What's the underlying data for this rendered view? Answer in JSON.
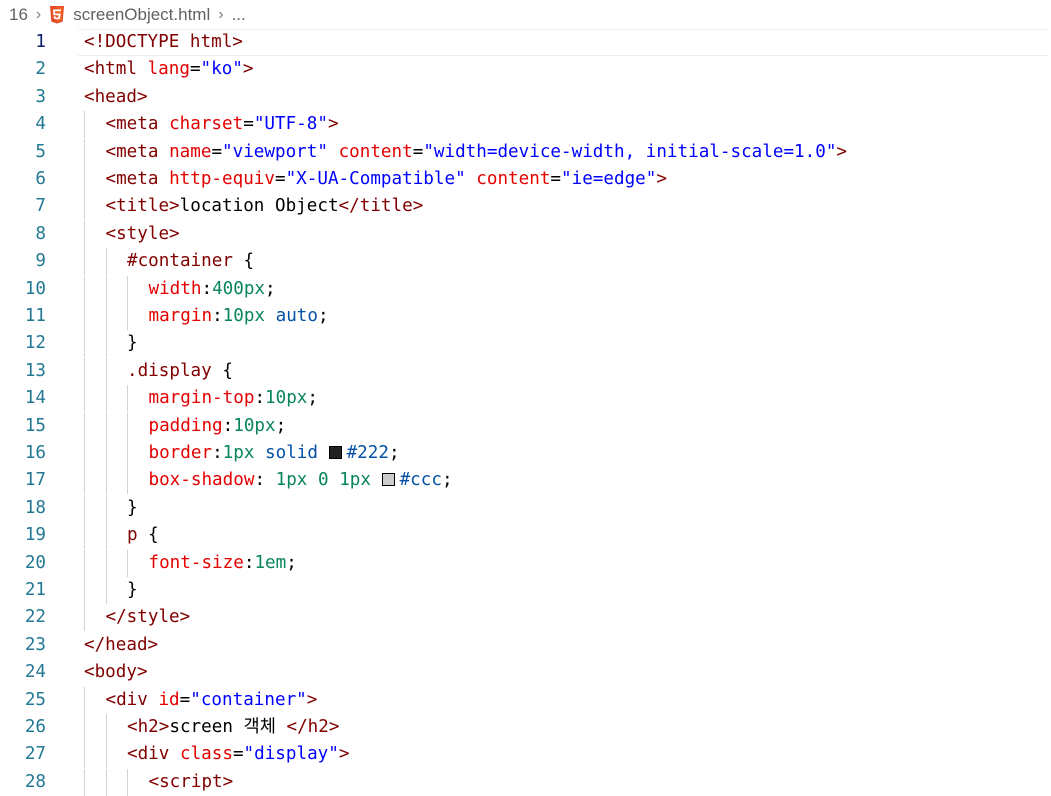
{
  "breadcrumb": {
    "line_ref": "16",
    "file_name": "screenObject.html",
    "more": "..."
  },
  "colors": {
    "line_number": "#237893",
    "tag": "#800000",
    "attribute": "#e50000",
    "string": "#0000ff",
    "number": "#098658",
    "keyword": "#0451a5",
    "html5_icon": "#e44d26"
  },
  "editor": {
    "current_line": 1,
    "lines": [
      {
        "n": "1",
        "indent": 0,
        "tokens": [
          [
            "t-tag",
            "<!DOCTYPE html>"
          ]
        ]
      },
      {
        "n": "2",
        "indent": 0,
        "tokens": [
          [
            "t-tag",
            "<html "
          ],
          [
            "t-attr",
            "lang"
          ],
          [
            "t-plain",
            "="
          ],
          [
            "t-val",
            "\"ko\""
          ],
          [
            "t-tag",
            ">"
          ]
        ]
      },
      {
        "n": "3",
        "indent": 0,
        "tokens": [
          [
            "t-tag",
            "<head>"
          ]
        ]
      },
      {
        "n": "4",
        "indent": 1,
        "tokens": [
          [
            "t-tag",
            "<meta "
          ],
          [
            "t-attr",
            "charset"
          ],
          [
            "t-plain",
            "="
          ],
          [
            "t-val",
            "\"UTF-8\""
          ],
          [
            "t-tag",
            ">"
          ]
        ]
      },
      {
        "n": "5",
        "indent": 1,
        "tokens": [
          [
            "t-tag",
            "<meta "
          ],
          [
            "t-attr",
            "name"
          ],
          [
            "t-plain",
            "="
          ],
          [
            "t-val",
            "\"viewport\""
          ],
          [
            "t-plain",
            " "
          ],
          [
            "t-attr",
            "content"
          ],
          [
            "t-plain",
            "="
          ],
          [
            "t-val",
            "\"width=device-width, initial-scale=1.0\""
          ],
          [
            "t-tag",
            ">"
          ]
        ]
      },
      {
        "n": "6",
        "indent": 1,
        "tokens": [
          [
            "t-tag",
            "<meta "
          ],
          [
            "t-attr",
            "http-equiv"
          ],
          [
            "t-plain",
            "="
          ],
          [
            "t-val",
            "\"X-UA-Compatible\""
          ],
          [
            "t-plain",
            " "
          ],
          [
            "t-attr",
            "content"
          ],
          [
            "t-plain",
            "="
          ],
          [
            "t-val",
            "\"ie=edge\""
          ],
          [
            "t-tag",
            ">"
          ]
        ]
      },
      {
        "n": "7",
        "indent": 1,
        "tokens": [
          [
            "t-tag",
            "<title>"
          ],
          [
            "t-text",
            "location Object"
          ],
          [
            "t-tag",
            "</title>"
          ]
        ]
      },
      {
        "n": "8",
        "indent": 1,
        "tokens": [
          [
            "t-tag",
            "<style>"
          ]
        ]
      },
      {
        "n": "9",
        "indent": 2,
        "tokens": [
          [
            "t-sel",
            "#container"
          ],
          [
            "t-plain",
            " {"
          ]
        ]
      },
      {
        "n": "10",
        "indent": 3,
        "tokens": [
          [
            "t-prop",
            "width"
          ],
          [
            "t-plain",
            ":"
          ],
          [
            "t-num",
            "400px"
          ],
          [
            "t-plain",
            ";"
          ]
        ]
      },
      {
        "n": "11",
        "indent": 3,
        "tokens": [
          [
            "t-prop",
            "margin"
          ],
          [
            "t-plain",
            ":"
          ],
          [
            "t-num",
            "10px"
          ],
          [
            "t-plain",
            " "
          ],
          [
            "t-kw",
            "auto"
          ],
          [
            "t-plain",
            ";"
          ]
        ]
      },
      {
        "n": "12",
        "indent": 2,
        "tokens": [
          [
            "t-plain",
            "}"
          ]
        ]
      },
      {
        "n": "13",
        "indent": 2,
        "tokens": [
          [
            "t-sel",
            ".display"
          ],
          [
            "t-plain",
            " {"
          ]
        ]
      },
      {
        "n": "14",
        "indent": 3,
        "tokens": [
          [
            "t-prop",
            "margin-top"
          ],
          [
            "t-plain",
            ":"
          ],
          [
            "t-num",
            "10px"
          ],
          [
            "t-plain",
            ";"
          ]
        ]
      },
      {
        "n": "15",
        "indent": 3,
        "tokens": [
          [
            "t-prop",
            "padding"
          ],
          [
            "t-plain",
            ":"
          ],
          [
            "t-num",
            "10px"
          ],
          [
            "t-plain",
            ";"
          ]
        ]
      },
      {
        "n": "16",
        "indent": 3,
        "tokens": [
          [
            "t-prop",
            "border"
          ],
          [
            "t-plain",
            ":"
          ],
          [
            "t-num",
            "1px"
          ],
          [
            "t-plain",
            " "
          ],
          [
            "t-kw",
            "solid"
          ],
          [
            "t-plain",
            " "
          ],
          [
            "swatch",
            "#222222"
          ],
          [
            "t-kw",
            "#222"
          ],
          [
            "t-plain",
            ";"
          ]
        ]
      },
      {
        "n": "17",
        "indent": 3,
        "tokens": [
          [
            "t-prop",
            "box-shadow"
          ],
          [
            "t-plain",
            ": "
          ],
          [
            "t-num",
            "1px"
          ],
          [
            "t-plain",
            " "
          ],
          [
            "t-num",
            "0"
          ],
          [
            "t-plain",
            " "
          ],
          [
            "t-num",
            "1px"
          ],
          [
            "t-plain",
            " "
          ],
          [
            "swatch",
            "#cccccc"
          ],
          [
            "t-kw",
            "#ccc"
          ],
          [
            "t-plain",
            ";"
          ]
        ]
      },
      {
        "n": "18",
        "indent": 2,
        "tokens": [
          [
            "t-plain",
            "}"
          ]
        ]
      },
      {
        "n": "19",
        "indent": 2,
        "tokens": [
          [
            "t-sel",
            "p"
          ],
          [
            "t-plain",
            " {"
          ]
        ]
      },
      {
        "n": "20",
        "indent": 3,
        "tokens": [
          [
            "t-prop",
            "font-size"
          ],
          [
            "t-plain",
            ":"
          ],
          [
            "t-num",
            "1em"
          ],
          [
            "t-plain",
            ";"
          ]
        ]
      },
      {
        "n": "21",
        "indent": 2,
        "tokens": [
          [
            "t-plain",
            "}"
          ]
        ]
      },
      {
        "n": "22",
        "indent": 1,
        "tokens": [
          [
            "t-tag",
            "</style>"
          ]
        ]
      },
      {
        "n": "23",
        "indent": 0,
        "tokens": [
          [
            "t-tag",
            "</head>"
          ]
        ]
      },
      {
        "n": "24",
        "indent": 0,
        "tokens": [
          [
            "t-tag",
            "<body>"
          ]
        ]
      },
      {
        "n": "25",
        "indent": 1,
        "tokens": [
          [
            "t-tag",
            "<div "
          ],
          [
            "t-attr",
            "id"
          ],
          [
            "t-plain",
            "="
          ],
          [
            "t-val",
            "\"container\""
          ],
          [
            "t-tag",
            ">"
          ]
        ]
      },
      {
        "n": "26",
        "indent": 2,
        "tokens": [
          [
            "t-tag",
            "<h2>"
          ],
          [
            "t-text",
            "screen 객체 "
          ],
          [
            "t-tag",
            "</h2>"
          ]
        ]
      },
      {
        "n": "27",
        "indent": 2,
        "tokens": [
          [
            "t-tag",
            "<div "
          ],
          [
            "t-attr",
            "class"
          ],
          [
            "t-plain",
            "="
          ],
          [
            "t-val",
            "\"display\""
          ],
          [
            "t-tag",
            ">"
          ]
        ]
      },
      {
        "n": "28",
        "indent": 3,
        "tokens": [
          [
            "t-tag",
            "<script>"
          ]
        ]
      }
    ]
  }
}
